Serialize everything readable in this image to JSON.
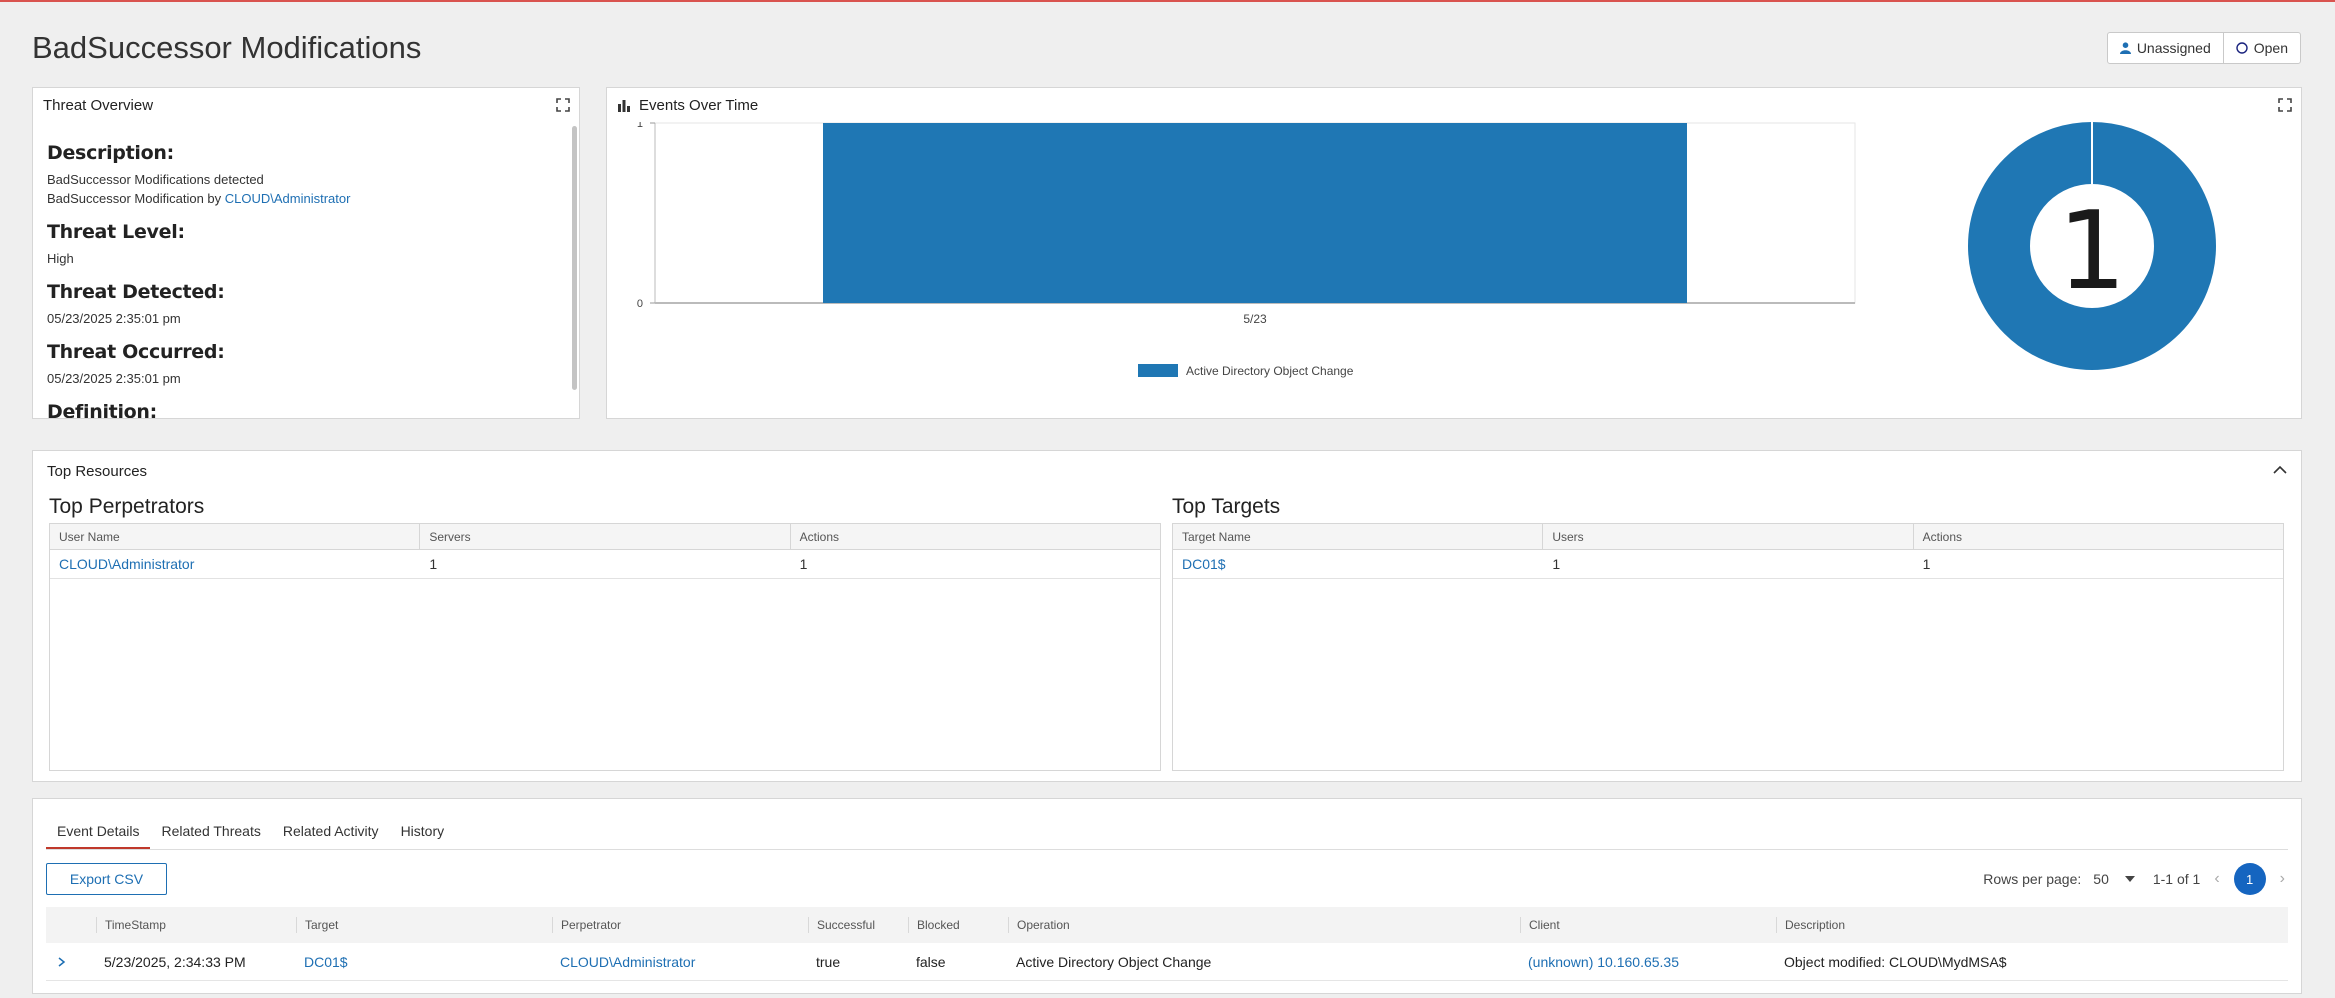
{
  "page": {
    "title": "BadSuccessor Modifications"
  },
  "status": {
    "assignee": "Unassigned",
    "state": "Open"
  },
  "threat_overview": {
    "title": "Threat Overview",
    "description_label": "Description:",
    "description_line1": "BadSuccessor Modifications detected",
    "description_line2_prefix": "BadSuccessor Modification by ",
    "description_line2_link": "CLOUD\\Administrator",
    "threat_level_label": "Threat Level:",
    "threat_level": "High",
    "threat_detected_label": "Threat Detected:",
    "threat_detected": "05/23/2025 2:35:01 pm",
    "threat_occurred_label": "Threat Occurred:",
    "threat_occurred": "05/23/2025 2:35:01 pm",
    "definition_label": "Definition:"
  },
  "events_over_time": {
    "title": "Events Over Time"
  },
  "chart_data": [
    {
      "type": "bar",
      "categories": [
        "5/23"
      ],
      "series": [
        {
          "name": "Active Directory Object Change",
          "values": [
            1
          ]
        }
      ],
      "ylim": [
        0,
        1
      ],
      "yticks": [
        "0",
        "1"
      ],
      "color": "#1f77b4",
      "legend": "bottom"
    },
    {
      "type": "pie",
      "style": "donut",
      "slices": [
        {
          "label": "Active Directory Object Change",
          "value": 1
        }
      ],
      "center_label": "1",
      "color": "#1f77b4"
    }
  ],
  "top_resources": {
    "title": "Top Resources",
    "perpetrators": {
      "title": "Top Perpetrators",
      "columns": [
        "User Name",
        "Servers",
        "Actions"
      ],
      "rows": [
        {
          "name": "CLOUD\\Administrator",
          "servers": "1",
          "actions": "1"
        }
      ]
    },
    "targets": {
      "title": "Top Targets",
      "columns": [
        "Target Name",
        "Users",
        "Actions"
      ],
      "rows": [
        {
          "name": "DC01$",
          "users": "1",
          "actions": "1"
        }
      ]
    }
  },
  "event_details": {
    "tabs": [
      "Event Details",
      "Related Threats",
      "Related Activity",
      "History"
    ],
    "export_label": "Export CSV",
    "rows_per_page_label": "Rows per page:",
    "rows_per_page": "50",
    "range": "1-1 of 1",
    "current_page": "1",
    "columns": [
      "TimeStamp",
      "Target",
      "Perpetrator",
      "Successful",
      "Blocked",
      "Operation",
      "Client",
      "Description"
    ],
    "rows": [
      {
        "timestamp": "5/23/2025, 2:34:33 PM",
        "target": "DC01$",
        "perpetrator": "CLOUD\\Administrator",
        "successful": "true",
        "blocked": "false",
        "operation": "Active Directory Object Change",
        "client": "(unknown) 10.160.65.35",
        "description": "Object modified: CLOUD\\MydMSA$"
      }
    ]
  }
}
